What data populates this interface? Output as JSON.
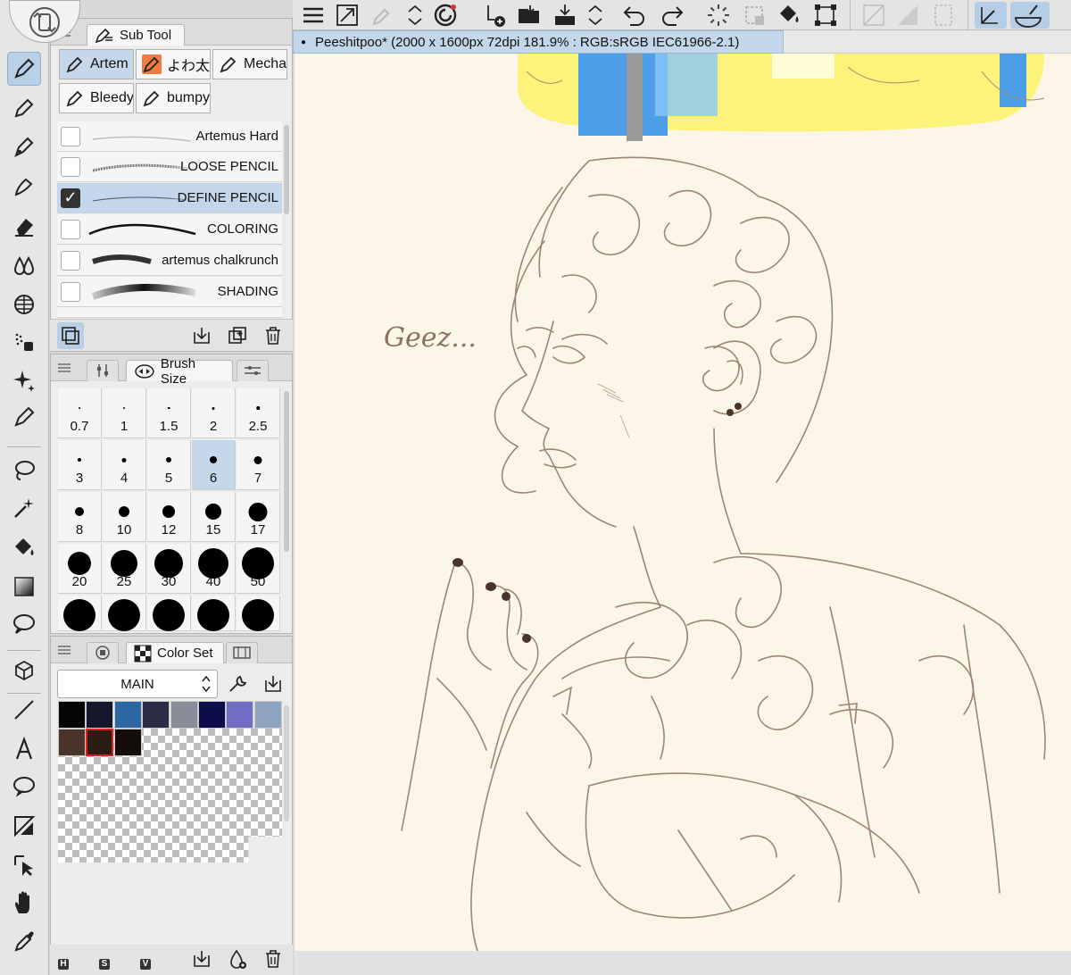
{
  "subtool_panel": {
    "tab_label": "Sub Tool",
    "chips": [
      {
        "label": "Artem",
        "active": true,
        "icon": "pencil-icon"
      },
      {
        "label": "よわ太",
        "active": false,
        "icon": "pencil-icon"
      },
      {
        "label": "Mecha",
        "active": false,
        "icon": "pencil-icon"
      },
      {
        "label": "Bleedy",
        "active": false,
        "icon": "pencil-icon"
      },
      {
        "label": "bumpy",
        "active": false,
        "icon": "pencil-icon"
      }
    ],
    "brushes": [
      {
        "name": "Artemus Hard",
        "checked": false
      },
      {
        "name": "LOOSE PENCIL",
        "checked": false
      },
      {
        "name": "DEFINE PENCIL",
        "checked": true
      },
      {
        "name": "COLORING",
        "checked": false
      },
      {
        "name": "artemus chalkrunch",
        "checked": false
      },
      {
        "name": "SHADING",
        "checked": false
      }
    ]
  },
  "brush_size_panel": {
    "tab_label": "Brush Size",
    "sizes": [
      "0.7",
      "1",
      "1.5",
      "2",
      "2.5",
      "3",
      "4",
      "5",
      "6",
      "7",
      "8",
      "10",
      "12",
      "15",
      "17",
      "20",
      "25",
      "30",
      "40",
      "50",
      "",
      "",
      "",
      "",
      ""
    ],
    "selected": "6"
  },
  "color_set_panel": {
    "tab_label": "Color Set",
    "set_name": "MAIN",
    "swatches_row1": [
      "#050505",
      "#15152b",
      "#2c66a3",
      "#2b2c45",
      "#8a8c98",
      "#0c0e4c",
      "#6f6dc4",
      "#8ea4c0"
    ],
    "swatches_row2": [
      "#4a3328",
      "#2b1d14",
      "#140d0b"
    ],
    "selected_swatch": "#2b1d14"
  },
  "document": {
    "tab_title": "Peeshitpoo* (2000 x 1600px 72dpi 181.9% : RGB:sRGB IEC61966-2.1)"
  },
  "canvas": {
    "sketch_text": "Geez...",
    "background": "#fcf6e8"
  },
  "color_mode_labels": [
    "H",
    "S",
    "V"
  ]
}
